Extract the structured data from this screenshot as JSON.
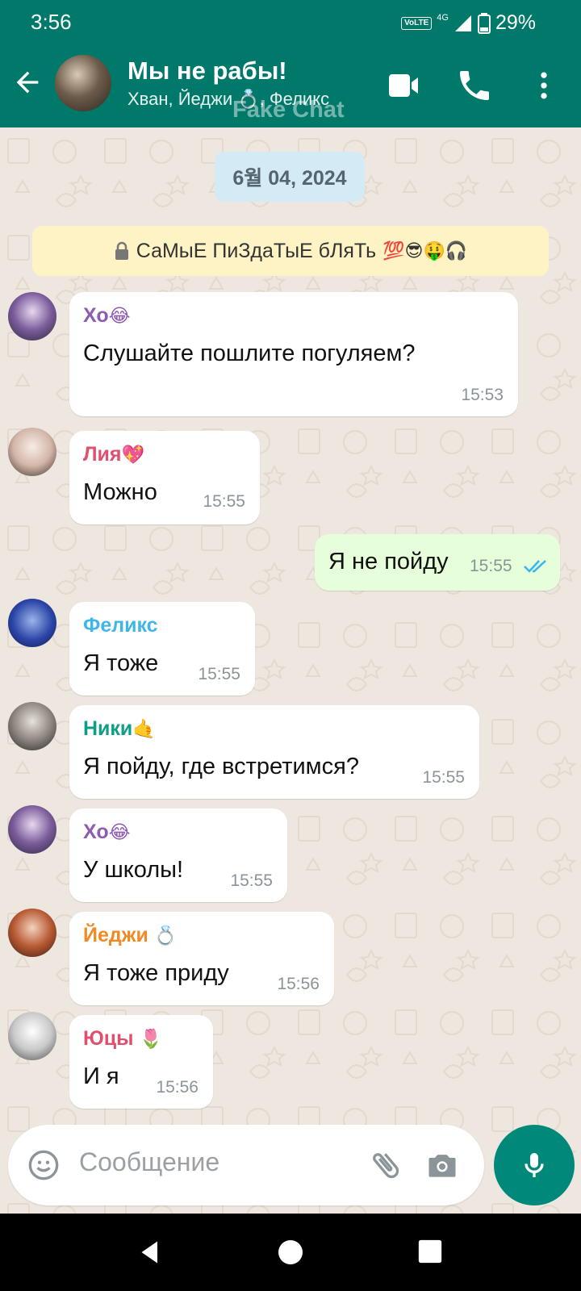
{
  "status_bar": {
    "time": "3:56",
    "volte": "VoLTE",
    "network": "4G",
    "battery": "29%"
  },
  "header": {
    "title": "Мы не рабы!",
    "subtitle": "Хван, Йеджи 💍, Феликс",
    "watermark": "Fake Chat"
  },
  "chat": {
    "date": "6월 04, 2024",
    "group_description": "СаМыЕ ПиЗдаТыЕ бЛяТь",
    "group_description_emoji": "💯😎🤑🎧",
    "messages": [
      {
        "sender": "Хо",
        "sender_emoji": "😂",
        "sender_color": "#8E5BB3",
        "text": "Слушайте пошлите погуляем?",
        "time": "15:53"
      },
      {
        "sender": "Лия",
        "sender_emoji": "💖",
        "sender_color": "#E0506E",
        "text": "Можно",
        "time": "15:55"
      },
      {
        "text": "Я не пойду",
        "time": "15:55",
        "outgoing": true
      },
      {
        "sender": "Феликс",
        "sender_emoji": "",
        "sender_color": "#3FB6E8",
        "text": "Я тоже",
        "time": "15:55"
      },
      {
        "sender": "Ники",
        "sender_emoji": "🤙",
        "sender_color": "#0E9E87",
        "text": "Я пойду, где встретимся?",
        "time": "15:55"
      },
      {
        "sender": "Хо",
        "sender_emoji": "😂",
        "sender_color": "#8E5BB3",
        "text": "У школы!",
        "time": "15:55"
      },
      {
        "sender": "Йеджи",
        "sender_emoji": "💍",
        "sender_color": "#F08A24",
        "text": "Я тоже приду",
        "time": "15:56"
      },
      {
        "sender": "Юцы",
        "sender_emoji": "🌷",
        "sender_color": "#E0506E",
        "text": "И я",
        "time": "15:56"
      }
    ]
  },
  "input": {
    "placeholder": "Сообщение"
  },
  "colors": {
    "header": "#00796B",
    "mic_button": "#00897B",
    "outgoing_bubble": "#E6FFDA",
    "read_ticks": "#34B7F1"
  },
  "icons": [
    "back-arrow-icon",
    "video-call-icon",
    "phone-icon",
    "more-vert-icon",
    "lock-icon",
    "emoji-icon",
    "attach-icon",
    "camera-icon",
    "mic-icon",
    "nav-back-icon",
    "nav-home-icon",
    "nav-recents-icon",
    "double-check-icon"
  ]
}
